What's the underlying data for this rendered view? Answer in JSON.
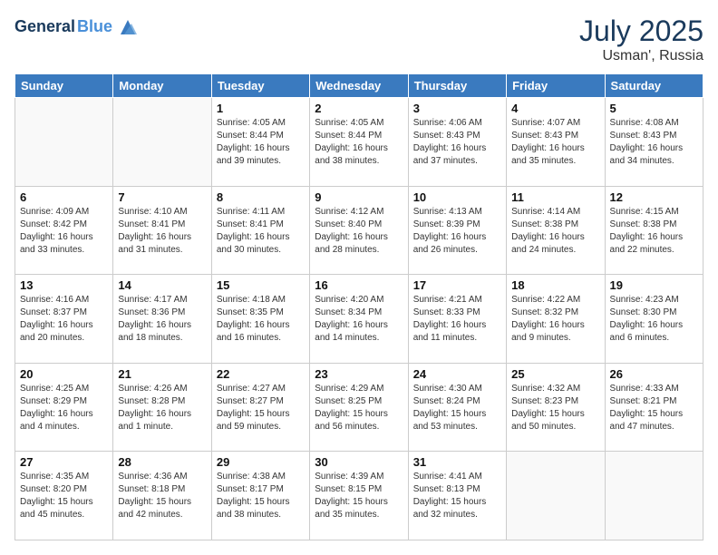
{
  "header": {
    "logo_line1": "General",
    "logo_line2": "Blue",
    "month_year": "July 2025",
    "location": "Usman', Russia"
  },
  "days_of_week": [
    "Sunday",
    "Monday",
    "Tuesday",
    "Wednesday",
    "Thursday",
    "Friday",
    "Saturday"
  ],
  "weeks": [
    [
      {
        "day": "",
        "info": ""
      },
      {
        "day": "",
        "info": ""
      },
      {
        "day": "1",
        "info": "Sunrise: 4:05 AM\nSunset: 8:44 PM\nDaylight: 16 hours and 39 minutes."
      },
      {
        "day": "2",
        "info": "Sunrise: 4:05 AM\nSunset: 8:44 PM\nDaylight: 16 hours and 38 minutes."
      },
      {
        "day": "3",
        "info": "Sunrise: 4:06 AM\nSunset: 8:43 PM\nDaylight: 16 hours and 37 minutes."
      },
      {
        "day": "4",
        "info": "Sunrise: 4:07 AM\nSunset: 8:43 PM\nDaylight: 16 hours and 35 minutes."
      },
      {
        "day": "5",
        "info": "Sunrise: 4:08 AM\nSunset: 8:43 PM\nDaylight: 16 hours and 34 minutes."
      }
    ],
    [
      {
        "day": "6",
        "info": "Sunrise: 4:09 AM\nSunset: 8:42 PM\nDaylight: 16 hours and 33 minutes."
      },
      {
        "day": "7",
        "info": "Sunrise: 4:10 AM\nSunset: 8:41 PM\nDaylight: 16 hours and 31 minutes."
      },
      {
        "day": "8",
        "info": "Sunrise: 4:11 AM\nSunset: 8:41 PM\nDaylight: 16 hours and 30 minutes."
      },
      {
        "day": "9",
        "info": "Sunrise: 4:12 AM\nSunset: 8:40 PM\nDaylight: 16 hours and 28 minutes."
      },
      {
        "day": "10",
        "info": "Sunrise: 4:13 AM\nSunset: 8:39 PM\nDaylight: 16 hours and 26 minutes."
      },
      {
        "day": "11",
        "info": "Sunrise: 4:14 AM\nSunset: 8:38 PM\nDaylight: 16 hours and 24 minutes."
      },
      {
        "day": "12",
        "info": "Sunrise: 4:15 AM\nSunset: 8:38 PM\nDaylight: 16 hours and 22 minutes."
      }
    ],
    [
      {
        "day": "13",
        "info": "Sunrise: 4:16 AM\nSunset: 8:37 PM\nDaylight: 16 hours and 20 minutes."
      },
      {
        "day": "14",
        "info": "Sunrise: 4:17 AM\nSunset: 8:36 PM\nDaylight: 16 hours and 18 minutes."
      },
      {
        "day": "15",
        "info": "Sunrise: 4:18 AM\nSunset: 8:35 PM\nDaylight: 16 hours and 16 minutes."
      },
      {
        "day": "16",
        "info": "Sunrise: 4:20 AM\nSunset: 8:34 PM\nDaylight: 16 hours and 14 minutes."
      },
      {
        "day": "17",
        "info": "Sunrise: 4:21 AM\nSunset: 8:33 PM\nDaylight: 16 hours and 11 minutes."
      },
      {
        "day": "18",
        "info": "Sunrise: 4:22 AM\nSunset: 8:32 PM\nDaylight: 16 hours and 9 minutes."
      },
      {
        "day": "19",
        "info": "Sunrise: 4:23 AM\nSunset: 8:30 PM\nDaylight: 16 hours and 6 minutes."
      }
    ],
    [
      {
        "day": "20",
        "info": "Sunrise: 4:25 AM\nSunset: 8:29 PM\nDaylight: 16 hours and 4 minutes."
      },
      {
        "day": "21",
        "info": "Sunrise: 4:26 AM\nSunset: 8:28 PM\nDaylight: 16 hours and 1 minute."
      },
      {
        "day": "22",
        "info": "Sunrise: 4:27 AM\nSunset: 8:27 PM\nDaylight: 15 hours and 59 minutes."
      },
      {
        "day": "23",
        "info": "Sunrise: 4:29 AM\nSunset: 8:25 PM\nDaylight: 15 hours and 56 minutes."
      },
      {
        "day": "24",
        "info": "Sunrise: 4:30 AM\nSunset: 8:24 PM\nDaylight: 15 hours and 53 minutes."
      },
      {
        "day": "25",
        "info": "Sunrise: 4:32 AM\nSunset: 8:23 PM\nDaylight: 15 hours and 50 minutes."
      },
      {
        "day": "26",
        "info": "Sunrise: 4:33 AM\nSunset: 8:21 PM\nDaylight: 15 hours and 47 minutes."
      }
    ],
    [
      {
        "day": "27",
        "info": "Sunrise: 4:35 AM\nSunset: 8:20 PM\nDaylight: 15 hours and 45 minutes."
      },
      {
        "day": "28",
        "info": "Sunrise: 4:36 AM\nSunset: 8:18 PM\nDaylight: 15 hours and 42 minutes."
      },
      {
        "day": "29",
        "info": "Sunrise: 4:38 AM\nSunset: 8:17 PM\nDaylight: 15 hours and 38 minutes."
      },
      {
        "day": "30",
        "info": "Sunrise: 4:39 AM\nSunset: 8:15 PM\nDaylight: 15 hours and 35 minutes."
      },
      {
        "day": "31",
        "info": "Sunrise: 4:41 AM\nSunset: 8:13 PM\nDaylight: 15 hours and 32 minutes."
      },
      {
        "day": "",
        "info": ""
      },
      {
        "day": "",
        "info": ""
      }
    ]
  ]
}
